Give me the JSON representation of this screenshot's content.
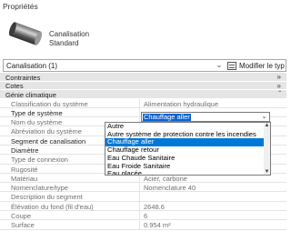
{
  "panel": {
    "title": "Propriétés"
  },
  "type_header": {
    "family": "Canalisation",
    "type": "Standard"
  },
  "selector": {
    "label": "Canalisation (1)",
    "edit_type_label": "Modifier le typ"
  },
  "groups": [
    {
      "label": "Contraintes",
      "toggle": "»"
    },
    {
      "label": "Cotes",
      "toggle": "»"
    },
    {
      "label": "Génie climatique",
      "toggle": "ˆ"
    }
  ],
  "rows": [
    {
      "label": "Classification du système",
      "value": "Alimentation hydraulique",
      "dim": true
    },
    {
      "label": "Type de système",
      "value": "",
      "dim": false
    },
    {
      "label": "Nom du système",
      "value": "",
      "dim": true
    },
    {
      "label": "Abréviation du système",
      "value": "",
      "dim": true
    },
    {
      "label": "Segment de canalisation",
      "value": "",
      "dim": false
    },
    {
      "label": "Diamètre",
      "value": "",
      "dim": false
    },
    {
      "label": "Type de connexion",
      "value": "",
      "dim": true
    },
    {
      "label": "Rugosité",
      "value": "",
      "dim": true
    },
    {
      "label": "Matériau",
      "value": "Acier, carbone",
      "dim": true
    },
    {
      "label": "Nomenclature/type",
      "value": "Nomenclature 40",
      "dim": true
    },
    {
      "label": "Description du segment",
      "value": "",
      "dim": true
    },
    {
      "label": "Élévation du fond (fil d'eau)",
      "value": "2648.6",
      "dim": true
    },
    {
      "label": "Coupe",
      "value": "6",
      "dim": true
    },
    {
      "label": "Surface",
      "value": "0.954 m²",
      "dim": true
    }
  ],
  "system_type_combo": {
    "value": "Chauffage aller"
  },
  "dropdown": {
    "options": [
      "Autre",
      "Autre système de protection contre les incendies",
      "Chauffage aller",
      "Chauffage retour",
      "Eau Chaude Sanitaire",
      "Eau Froide Sanitaire",
      "Eau glacée"
    ],
    "selected_index": 2
  },
  "colors": {
    "selection": "#0078d7",
    "group_bg": "#e5e5e5"
  }
}
